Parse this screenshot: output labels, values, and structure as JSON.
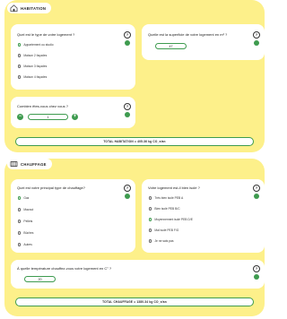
{
  "habitation": {
    "title": "HABITATION",
    "q_type": "Quel est le type de votre logement ?",
    "type_options": [
      "Appartement ou studio",
      "Maison 2 façades",
      "Maison 3 façades",
      "Maison 4 façades"
    ],
    "type_selected": 0,
    "q_surface": "Quelle est la superficie de votre logement en m² ?",
    "surface_value": "47",
    "q_people": "Combien êtes-vous chez vous ?",
    "people_value": "1",
    "minus": "−",
    "plus": "+",
    "total_label": "TOTAL HABITATION",
    "total_value": "= 405.36 kg CO_e/an"
  },
  "chauffage": {
    "title": "CHAUFFAGE",
    "q_heating": "Quel est votre principal type de chauffage?",
    "heating_options": [
      "Gaz",
      "Mazout",
      "Pellets",
      "Bûches",
      "Autres"
    ],
    "heating_selected": 0,
    "q_insulation": "Votre logement est-il bien isolé ?",
    "insulation_options": [
      "Très bien isolé PEB A",
      "Bien isolé PEB B/C",
      "Moyennement isolé PEB D/E",
      "Mal isolé PEB F/G",
      "Je ne sais pas"
    ],
    "insulation_selected": 2,
    "q_temp": "À quelle température chauffez-vous votre logement en C° ?",
    "temp_value": "20",
    "total_label": "TOTAL CHAUFFAGE",
    "total_value": "= 1380.34 kg CO_e/an"
  },
  "colors": {
    "accent": "#3e9b4f",
    "section_bg": "#fdf08a"
  },
  "icons": {
    "info": "question-circle-icon",
    "tip": "lightbulb-icon",
    "habitation": "house-icon",
    "chauffage": "radiator-icon"
  }
}
